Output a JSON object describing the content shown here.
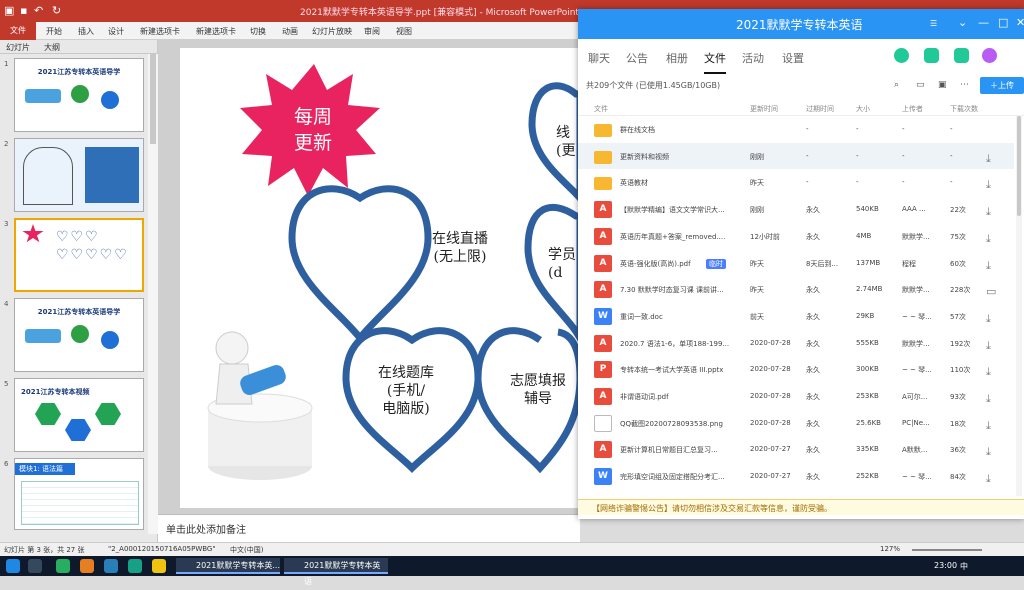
{
  "ppt": {
    "window_title": "2021默默学专转本英语导学.ppt [兼容模式] - Microsoft PowerPoint",
    "file_tab": "文件",
    "ribbon_tabs": [
      "开始",
      "插入",
      "设计",
      "新建选项卡",
      "新建选项卡",
      "切换",
      "动画",
      "幻灯片放映",
      "审阅",
      "视图"
    ],
    "side_tabs": [
      "幻灯片",
      "大纲"
    ],
    "slides": [
      {
        "num": "1",
        "title": "2021江苏专转本英语导学"
      },
      {
        "num": "2",
        "title": ""
      },
      {
        "num": "3",
        "title": ""
      },
      {
        "num": "4",
        "title": "2021江苏专转本英语导学"
      },
      {
        "num": "5",
        "title": "2021江苏专转本视频"
      },
      {
        "num": "6",
        "title": "模块1: 语法篇"
      },
      {
        "num": "7",
        "title": ""
      }
    ],
    "slide3": {
      "star": "每周\n更新",
      "hearts": [
        "在线直播\n(无上限)",
        "学员\n(d",
        "在线题库\n(手机/\n电脑版)",
        "志愿填报\n辅导",
        "线\n(更"
      ]
    },
    "notes_placeholder": "单击此处添加备注",
    "status": {
      "slide_info": "幻灯片 第 3 张，共 27 张",
      "theme": "\"2_A000120150716A05PWBG\"",
      "lang": "中文(中国)",
      "zoom": "127%"
    }
  },
  "chat": {
    "title": "2021默默学专转本英语",
    "nav_tabs": [
      "聊天",
      "公告",
      "相册",
      "文件",
      "活动",
      "设置"
    ],
    "active_tab": "文件",
    "file_summary": "共209个文件 (已使用1.45GB/10GB)",
    "upload_label": "上传",
    "columns": [
      "文件",
      "更新时间",
      "过期时间",
      "大小",
      "上传者",
      "下载次数"
    ],
    "files": [
      {
        "type": "folder",
        "name": "群在线文档",
        "updated": "",
        "expire": "-",
        "size": "-",
        "uploader": "-",
        "downloads": "-"
      },
      {
        "type": "folder",
        "name": "更新资料和视频",
        "updated": "刚刚",
        "expire": "-",
        "size": "-",
        "uploader": "-",
        "downloads": "-"
      },
      {
        "type": "folder",
        "name": "英语教材",
        "updated": "昨天",
        "expire": "-",
        "size": "-",
        "uploader": "-",
        "downloads": "-"
      },
      {
        "type": "pdf",
        "name": "【默默学精编】语文文学常识大...",
        "updated": "刚刚",
        "expire": "永久",
        "size": "540KB",
        "uploader": "AAA ...",
        "downloads": "22次"
      },
      {
        "type": "pdf",
        "name": "英语历年真题+答案_removed....",
        "updated": "12小时前",
        "expire": "永久",
        "size": "4MB",
        "uploader": "默默学...",
        "downloads": "75次"
      },
      {
        "type": "pdf",
        "name": "英语-强化版(高尚).pdf",
        "tag": "临时",
        "updated": "昨天",
        "expire": "8天后到...",
        "size": "137MB",
        "uploader": "程程",
        "downloads": "60次"
      },
      {
        "type": "pdf",
        "name": "7.30 默默学时态复习课 课前讲...",
        "updated": "昨天",
        "expire": "永久",
        "size": "2.74MB",
        "uploader": "默默学...",
        "downloads": "228次"
      },
      {
        "type": "word",
        "name": "重词一致.doc",
        "updated": "前天",
        "expire": "永久",
        "size": "29KB",
        "uploader": "~ ~ 琴...",
        "downloads": "57次"
      },
      {
        "type": "pdf",
        "name": "2020.7 语法1-6，单项188-199...",
        "updated": "2020-07-28",
        "expire": "永久",
        "size": "555KB",
        "uploader": "默默学...",
        "downloads": "192次"
      },
      {
        "type": "ppt",
        "name": "专转本统一考试大学英语 III.pptx",
        "updated": "2020-07-28",
        "expire": "永久",
        "size": "300KB",
        "uploader": "~ ~ 琴...",
        "downloads": "110次"
      },
      {
        "type": "pdf",
        "name": "非谓语动词.pdf",
        "updated": "2020-07-28",
        "expire": "永久",
        "size": "253KB",
        "uploader": "A可尔...",
        "downloads": "93次"
      },
      {
        "type": "img",
        "name": "QQ截图20200728093538.png",
        "updated": "2020-07-28",
        "expire": "永久",
        "size": "25.6KB",
        "uploader": "PC|Ne...",
        "downloads": "18次"
      },
      {
        "type": "pdf",
        "name": "更新计算机日常题目汇总复习...",
        "updated": "2020-07-27",
        "expire": "永久",
        "size": "335KB",
        "uploader": "A默默...",
        "downloads": "36次"
      },
      {
        "type": "word",
        "name": "完形填空词组及固定搭配分考汇...",
        "updated": "2020-07-27",
        "expire": "永久",
        "size": "252KB",
        "uploader": "~ ~ 琴...",
        "downloads": "84次"
      }
    ],
    "footer_notice": "【网络诈骗警惕公告】请切勿相信涉及交易汇款等信息，谨防受骗。"
  },
  "taskbar": {
    "tasks": [
      "2021默默学专转本英...",
      "2021默默学专转本英语"
    ],
    "time": "23:00",
    "ime": "中"
  },
  "colors": {
    "ppt_red": "#c0392b",
    "qq_blue": "#2a94f4",
    "heart_blue": "#2e5f9e",
    "star_pink": "#e8235f"
  }
}
